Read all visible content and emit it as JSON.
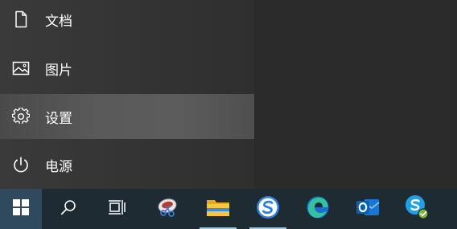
{
  "start_menu": {
    "items": [
      {
        "label": "文档",
        "icon": "document-icon"
      },
      {
        "label": "图片",
        "icon": "pictures-icon"
      },
      {
        "label": "设置",
        "icon": "settings-gear-icon",
        "highlighted": true
      },
      {
        "label": "电源",
        "icon": "power-icon"
      }
    ]
  },
  "taskbar": {
    "buttons": [
      {
        "icon": "windows-start-icon"
      },
      {
        "icon": "search-icon"
      },
      {
        "icon": "task-view-icon"
      },
      {
        "icon": "snipping-tool-icon"
      },
      {
        "icon": "file-explorer-icon"
      },
      {
        "icon": "sogou-app-icon"
      },
      {
        "icon": "edge-browser-icon"
      },
      {
        "icon": "outlook-icon"
      },
      {
        "icon": "skype-icon"
      }
    ]
  },
  "colors": {
    "taskbar_bg": "#1f2b33",
    "start_button_bg": "#2f4a5e",
    "highlight": "#5a5a5a"
  }
}
